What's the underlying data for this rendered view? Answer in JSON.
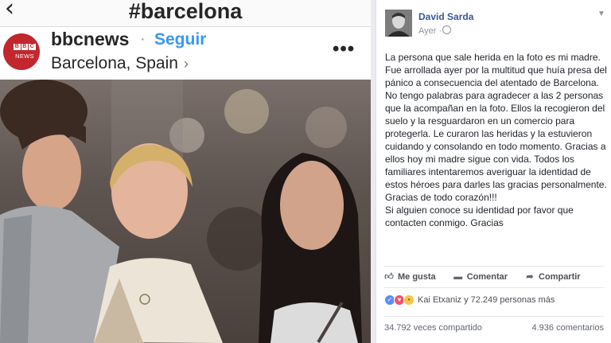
{
  "instagram": {
    "hashtag": "#barcelona",
    "back_icon": "chevron-left-icon",
    "avatar": {
      "brand_top": [
        "B",
        "B",
        "C"
      ],
      "brand_bottom": "NEWS",
      "color": "#c1272d"
    },
    "username": "bbcnews",
    "separator": "·",
    "follow_label": "Seguir",
    "follow_color": "#3897f0",
    "location": "Barcelona, Spain",
    "location_chevron": "›",
    "more_icon": "•••"
  },
  "facebook": {
    "author": "David Sarda",
    "time": "Ayer ·",
    "author_color": "#365899",
    "post_paragraphs": [
      "La persona que sale herida en la foto es mi madre. Fue arrollada ayer por la multitud que huía presa del pánico a consecuencia del atentado de Barcelona. No tengo palabras para agradecer a las 2 personas que la acompañan en la foto. Ellos la recogieron del suelo y la resguardaron en un comercio para protegerla. Le curaron las heridas y la estuvieron cuidando y consolando en todo momento. Gracias a ellos hoy mi madre sigue con vida. Todos los familiares intentaremos averiguar la identidad de estos héroes para darles las gracias personalmente. Gracias de todo corazón!!!",
      "Si alguien conoce su identidad por favor que contacten conmigo. Gracias"
    ],
    "actions": {
      "like": "Me gusta",
      "comment": "Comentar",
      "share": "Compartir"
    },
    "reactions_text": "Kai Etxaniz y 72.249 personas más",
    "shares": "34.792 veces compartido",
    "comments": "4.936 comentarios"
  }
}
